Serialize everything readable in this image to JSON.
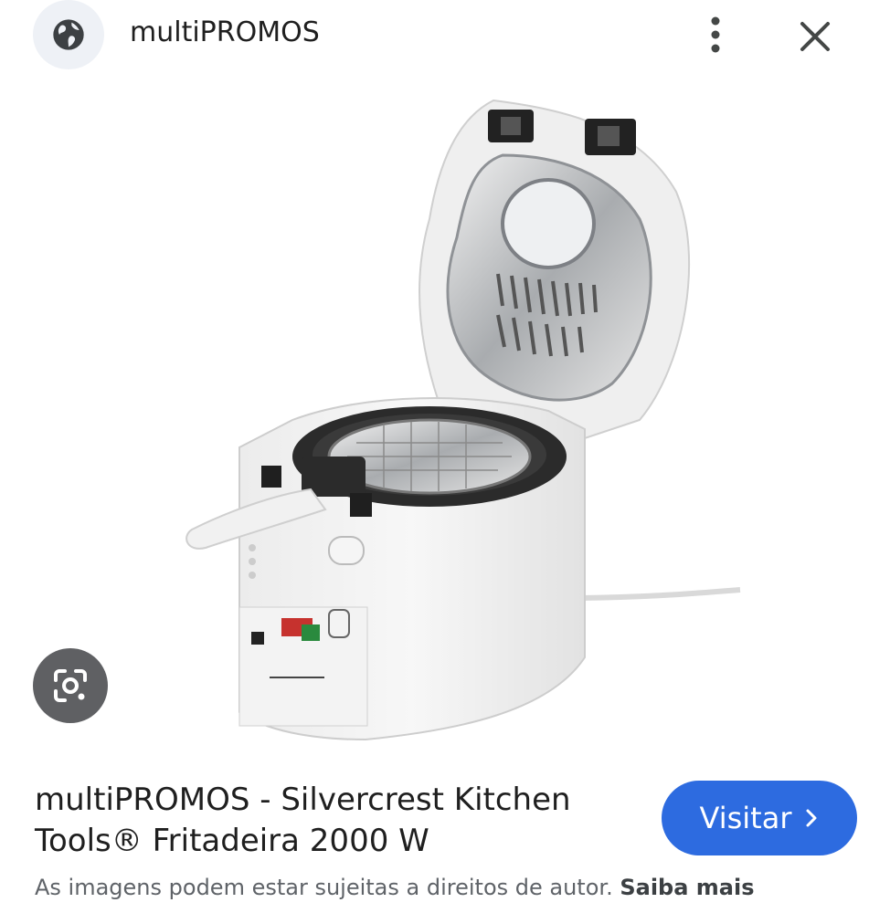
{
  "header": {
    "site_icon": "globe-icon",
    "site_name": "multiPROMOS",
    "menu_icon": "more-vert-icon",
    "close_icon": "close-icon"
  },
  "image": {
    "description_icon": "product-image",
    "lens_icon": "google-lens-icon"
  },
  "result": {
    "title_line1": "multiPROMOS - Silvercrest Kitchen",
    "title_line2": "Tools® Fritadeira 2000 W",
    "visit_label": "Visitar",
    "visit_icon": "chevron-right-icon"
  },
  "footer": {
    "disclaimer": "As imagens podem estar sujeitas a direitos de autor.",
    "learn_more": "Saiba mais"
  },
  "colors": {
    "accent": "#2d6be0",
    "globe_bg": "#eef1f6",
    "lens_bg": "#5f6063"
  }
}
